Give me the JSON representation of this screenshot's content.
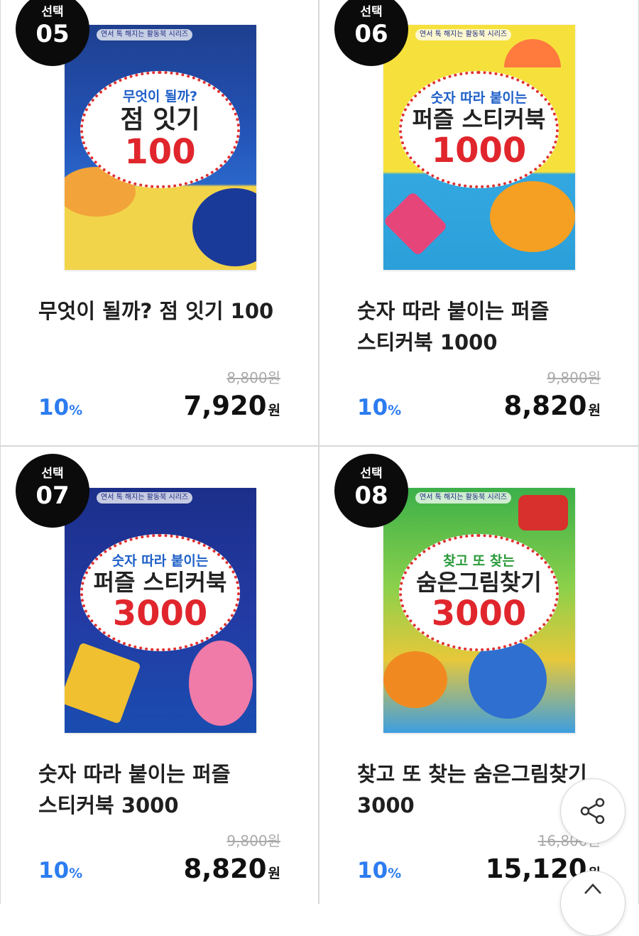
{
  "badge_label": "선택",
  "currency": "원",
  "products": [
    {
      "number": "05",
      "title_lines": [
        "무엇이 될까? 점 잇기 100"
      ],
      "original_price": "8,800원",
      "discount_value": "10",
      "discount_unit": "%",
      "sale_price": "7,920",
      "cover": {
        "small_text": "무엇이 될까?",
        "main_text": "점 잇기",
        "number_text": "100",
        "series_tag": "연서 톡 해지는 활동북 시리즈"
      }
    },
    {
      "number": "06",
      "title_lines": [
        "숫자 따라 붙이는 퍼즐",
        "스티커북 1000"
      ],
      "original_price": "9,800원",
      "discount_value": "10",
      "discount_unit": "%",
      "sale_price": "8,820",
      "cover": {
        "small_text": "숫자 따라 붙이는",
        "main_text": "퍼즐 스티커북",
        "number_text": "1000",
        "series_tag": "연서 톡 해지는 활동북 시리즈"
      }
    },
    {
      "number": "07",
      "title_lines": [
        "숫자 따라 붙이는 퍼즐",
        "스티커북 3000"
      ],
      "original_price": "9,800원",
      "discount_value": "10",
      "discount_unit": "%",
      "sale_price": "8,820",
      "cover": {
        "small_text": "숫자 따라 붙이는",
        "main_text": "퍼즐 스티커북",
        "number_text": "3000",
        "series_tag": "연서 톡 해지는 활동북 시리즈"
      }
    },
    {
      "number": "08",
      "title_lines": [
        "찾고 또 찾는 숨은그림찾기",
        "3000"
      ],
      "original_price": "16,800원",
      "discount_value": "10",
      "discount_unit": "%",
      "sale_price": "15,120",
      "cover": {
        "small_text": "찾고 또 찾는",
        "main_text": "숨은그림찾기",
        "number_text": "3000",
        "series_tag": "연서 톡 해지는 활동북 시리즈"
      }
    }
  ],
  "icons": {
    "share": "share-icon",
    "scroll_top": "arrow-up-icon"
  }
}
